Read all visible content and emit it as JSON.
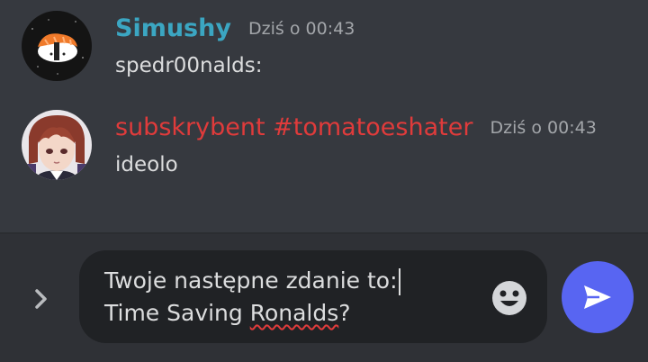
{
  "messages": [
    {
      "username": "Simushy",
      "timestamp": "Dziś o 00:43",
      "content": "spedr00nalds:",
      "avatar_icon": "sushi-avatar-icon"
    },
    {
      "username": "subskrybent #tomatoeshater",
      "timestamp": "Dziś o 00:43",
      "content": "ideolo",
      "avatar_icon": "anime-character-avatar-icon"
    }
  ],
  "composer": {
    "line1": "Twoje następne zdanie to:",
    "line2_before": "Time Saving ",
    "line2_typo": "Ronalds",
    "line2_after": "?"
  },
  "colors": {
    "background": "#36393f",
    "composer_bg": "#2f3136",
    "input_bg": "#202225",
    "username1": "#3ba6c2",
    "username2": "#e03b3b",
    "timestamp": "#a3a6aa",
    "send_button": "#5865f2"
  }
}
